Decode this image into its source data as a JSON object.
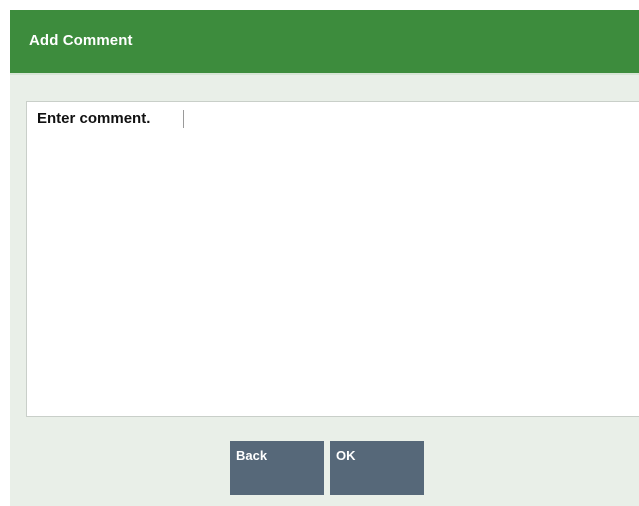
{
  "dialog": {
    "title": "Add Comment"
  },
  "comment": {
    "placeholder": "Enter comment."
  },
  "buttons": {
    "back_label": "Back",
    "ok_label": "OK"
  },
  "colors": {
    "header": "#3d8c3d",
    "button": "#566879",
    "panel": "#e9efe8"
  }
}
